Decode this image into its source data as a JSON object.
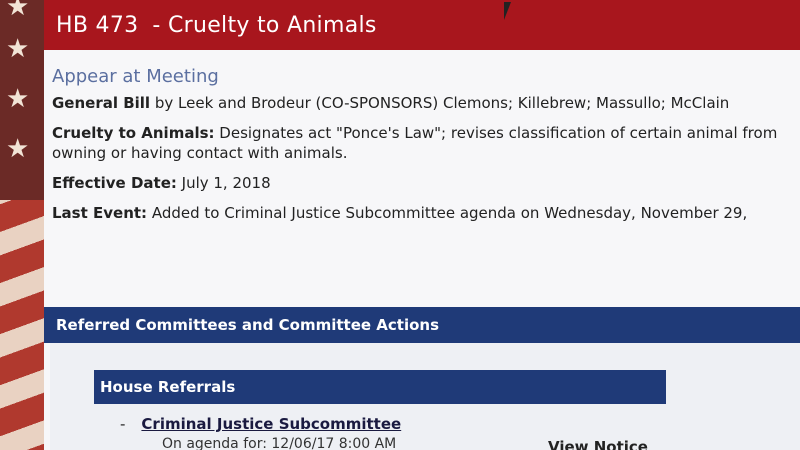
{
  "header": {
    "bill_number": "HB 473",
    "bill_title": "- Cruelty to Animals"
  },
  "summary": {
    "appear_link": "Appear at Meeting",
    "general_bill_label": "General Bill",
    "general_bill_text": " by Leek and Brodeur (CO-SPONSORS) Clemons; Killebrew; Massullo; McClain",
    "cruelty_label": "Cruelty to Animals:",
    "cruelty_text": " Designates act \"Ponce's Law\"; revises classification of certain animal from owning or having contact with animals.",
    "effective_label": "Effective Date:",
    "effective_value": " July 1, 2018",
    "last_event_label": "Last Event:",
    "last_event_text": " Added to Criminal Justice Subcommittee agenda on Wednesday, November 29,"
  },
  "committees": {
    "section_title": "Referred Committees and Committee Actions",
    "house_referrals_title": "House Referrals",
    "dash": "-",
    "committee_name": "Criminal Justice Subcommittee",
    "agenda_text": "On agenda for: 12/06/17 8:00 AM",
    "view_notice": "View Notice"
  },
  "icons": {
    "cursor": "mouse-pointer-icon",
    "star": "star-icon"
  },
  "colors": {
    "title_red": "#a8161d",
    "section_navy": "#1f3a78"
  }
}
